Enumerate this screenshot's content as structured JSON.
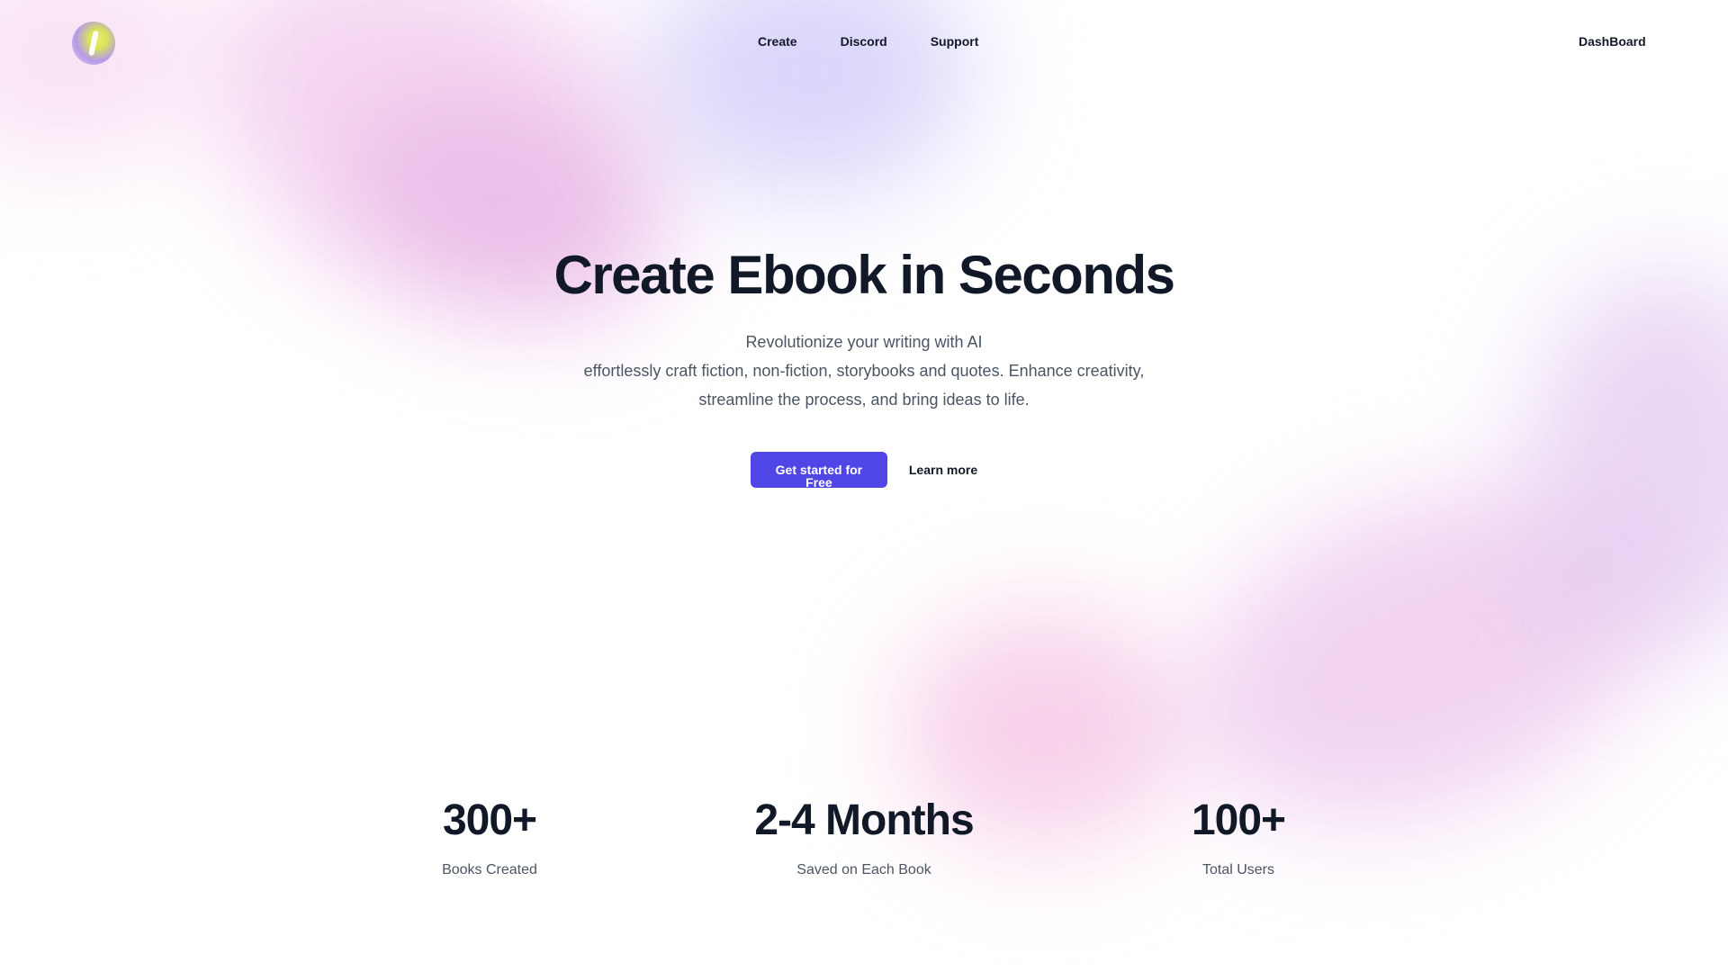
{
  "header": {
    "nav": [
      {
        "label": "Create"
      },
      {
        "label": "Discord"
      },
      {
        "label": "Support"
      }
    ],
    "dashboard_label": "DashBoard",
    "logo_icon": "quill-logo-icon"
  },
  "hero": {
    "title": "Create Ebook in Seconds",
    "subtitle_line1": "Revolutionize your writing with AI",
    "subtitle_line2": "effortlessly craft fiction, non-fiction, storybooks and quotes. Enhance creativity,",
    "subtitle_line3": "streamline the process, and bring ideas to life.",
    "primary_cta": "Get started for Free",
    "secondary_cta": "Learn more"
  },
  "stats": [
    {
      "value": "300+",
      "label": "Books Created"
    },
    {
      "value": "2-4 Months",
      "label": "Saved on Each Book"
    },
    {
      "value": "100+",
      "label": "Total Users"
    }
  ],
  "colors": {
    "accent": "#4f46e5",
    "text": "#111827",
    "muted": "#4b5563"
  }
}
